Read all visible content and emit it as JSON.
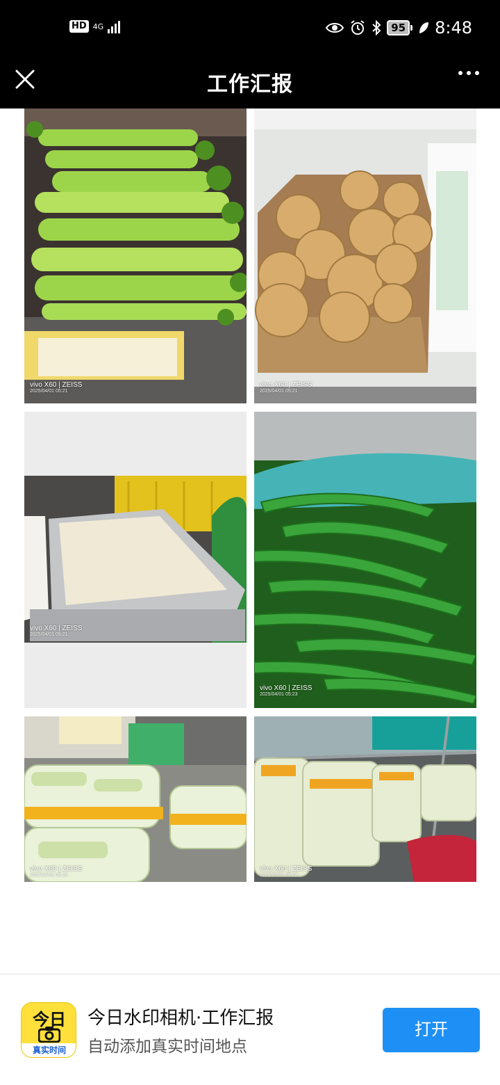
{
  "status_bar": {
    "hd_label": "HD",
    "network_label": "4G",
    "battery_level": "95",
    "time": "8:48"
  },
  "header": {
    "title": "工作汇报"
  },
  "photos": [
    {
      "camera": "vivo X60 | ZEISS",
      "timestamp": "2025/04/01 05:21"
    },
    {
      "camera": "vivo X60 | ZEISS",
      "timestamp": "2025/04/01 05:21"
    },
    {
      "camera": "vivo X60 | ZEISS",
      "timestamp": "2025/04/01 05:21"
    },
    {
      "camera": "vivo X60 | ZEISS",
      "timestamp": "2025/04/01 05:23"
    },
    {
      "camera": "vivo X60 | ZEISS",
      "timestamp": "2025/04/01 05:22"
    },
    {
      "camera": "vivo X60 | ZEISS",
      "timestamp": "2025/04/01 05:22"
    }
  ],
  "banner": {
    "app_icon_title": "今日",
    "app_icon_caption": "真实时间",
    "title": "今日水印相机·工作汇报",
    "subtitle": "自动添加真实时间地点",
    "open_button": "打开"
  },
  "colors": {
    "accent": "#1e90f5",
    "app_icon": "#ffe03a",
    "header_bg": "#000000"
  }
}
